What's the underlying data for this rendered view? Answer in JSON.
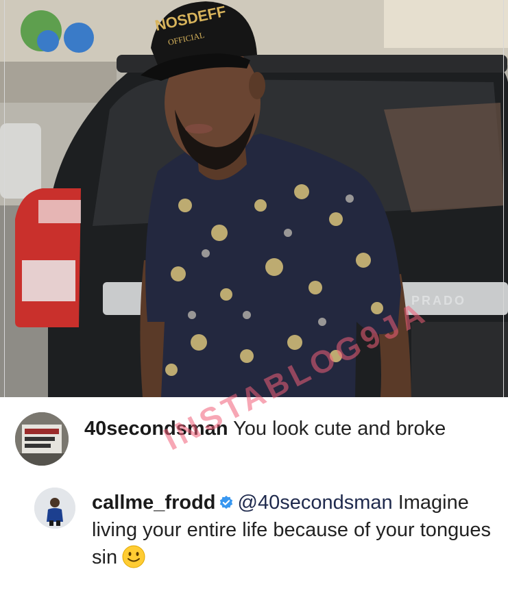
{
  "post": {
    "photo": {
      "cap_text_line1": "NOSDEFF",
      "cap_text_line2": "OFFICIAL",
      "car_badge": "PRADO"
    }
  },
  "comments": [
    {
      "username": "40secondsman",
      "text": "You look cute and broke",
      "avatar_icon": "profile-avatar-icon"
    },
    {
      "username": "callme_frodd",
      "verified": true,
      "mention": "@40secondsman",
      "text": "Imagine living your entire life because of your tongues sin",
      "emoji": "slightly-smiling-face"
    }
  ],
  "watermark": "INSTABLOG9JA",
  "colors": {
    "verified_badge": "#3897f0",
    "watermark": "#f05f78"
  }
}
